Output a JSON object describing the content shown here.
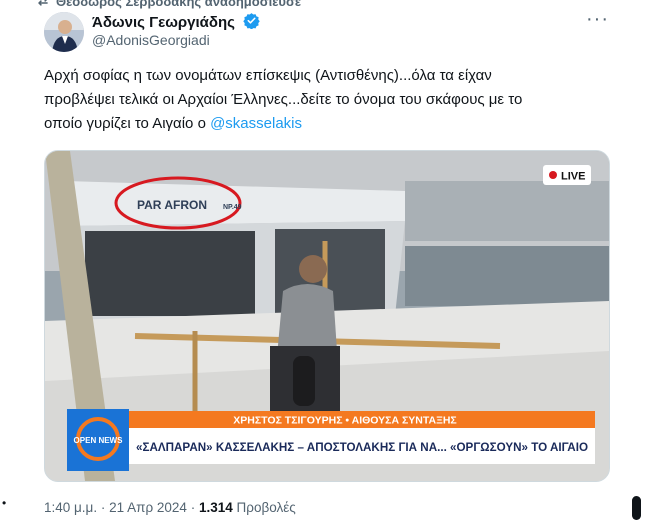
{
  "retweet_line": "Θεόδωρος Σερβόδάκης αναδημοσίευσε",
  "author": {
    "name": "Άδωνις Γεωργιάδης",
    "handle": "@AdonisGeorgiadi"
  },
  "more_label": "···",
  "tweet": {
    "line1": "Αρχή σοφίας η των ονομάτων επίσκεψις (Αντισθένης)...όλα τα είχαν",
    "line2": "προβλέψει τελικά οι Αρχαίοι Έλληνες...δείτε το όνομα του σκάφους με το",
    "line3_prefix": "οποίο γυρίζει το Αιγαίο ο ",
    "mention": "@skasselakis"
  },
  "media": {
    "live_label": "LIVE",
    "boat_name": "PAR AFRON",
    "boat_suffix": "NP.49",
    "reporter_bar": "ΧΡΗΣΤΟΣ ΤΣΙΓΟΥΡΗΣ  •  ΑΙΘΟΥΣΑ ΣΥΝΤΑΞΗΣ",
    "headline": "«ΣΑΛΠΑΡΑΝ» ΚΑΣΣΕΛΑΚΗΣ – ΑΠΟΣΤΟΛΑΚΗΣ ΓΙΑ ΝΑ... «ΟΡΓΩΣΟΥΝ» ΤΟ ΑΙΓΑΙΟ",
    "channel_logo": "OPEN NEWS"
  },
  "meta": {
    "time": "1:40 μ.μ.",
    "sep": "·",
    "date": "21 Απρ 2024",
    "views_count": "1.314",
    "views_label": "Προβολές"
  },
  "colors": {
    "accent": "#1d9bf0",
    "muted": "#536471",
    "banner_orange": "#f47920"
  }
}
